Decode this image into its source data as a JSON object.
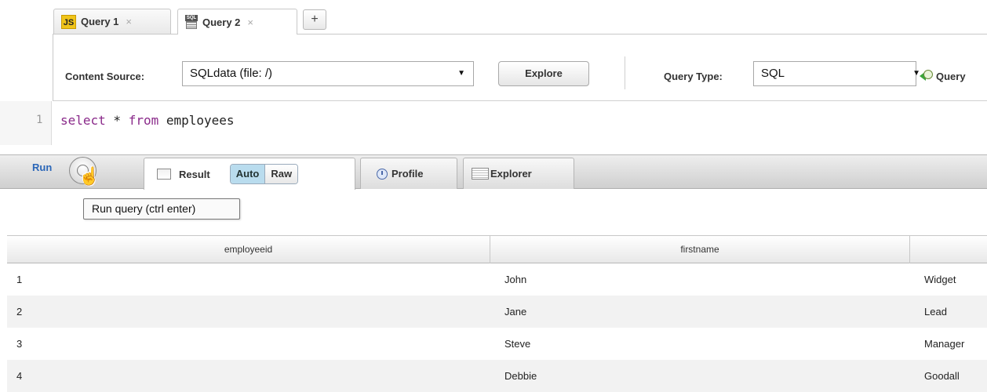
{
  "query_tabs": [
    {
      "label": "Query 1",
      "close": "×",
      "icon": "js-file-icon",
      "icon_text": "JS"
    },
    {
      "label": "Query 2",
      "close": "×",
      "icon": "sql-file-icon",
      "icon_text": "SQL"
    }
  ],
  "add_tab_label": "+",
  "config": {
    "content_source_label": "Content Source:",
    "content_source_value": "SQLdata (file: /)",
    "explore_label": "Explore",
    "query_type_label": "Query Type:",
    "query_type_value": "SQL",
    "query_link_label": "Query"
  },
  "editor": {
    "line_number": "1",
    "tokens": [
      {
        "text": "select",
        "kind": "keyword"
      },
      {
        "text": " * ",
        "kind": "plain"
      },
      {
        "text": "from",
        "kind": "keyword"
      },
      {
        "text": " employees",
        "kind": "plain"
      }
    ]
  },
  "toolbar": {
    "run_label": "Run",
    "result_tab_label": "Result",
    "auto_label": "Auto",
    "raw_label": "Raw",
    "profile_tab_label": "Profile",
    "explorer_tab_label": "Explorer"
  },
  "tooltip": "Run query (ctrl enter)",
  "grid": {
    "columns": [
      "employeeid",
      "firstname",
      ""
    ],
    "rows": [
      [
        "1",
        "John",
        "Widget"
      ],
      [
        "2",
        "Jane",
        "Lead"
      ],
      [
        "3",
        "Steve",
        "Manager"
      ],
      [
        "4",
        "Debbie",
        "Goodall"
      ]
    ]
  },
  "colors": {
    "accent_blue": "#2a66b8",
    "keyword_purple": "#8a2a8a",
    "auto_selected": "#b9dcee"
  }
}
